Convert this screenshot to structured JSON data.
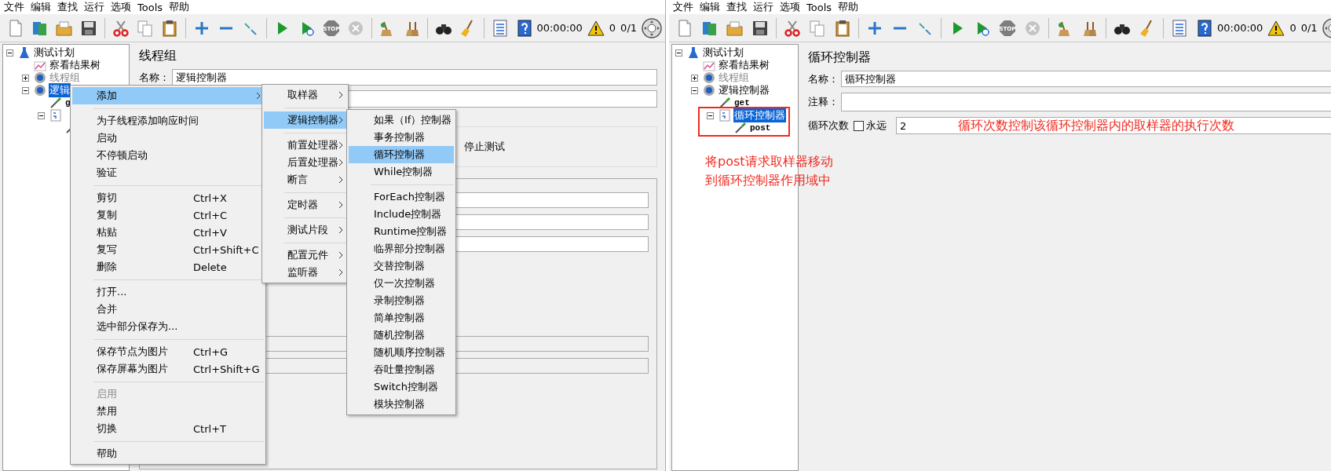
{
  "left_window": {
    "menu": [
      "文件",
      "编辑",
      "查找",
      "运行",
      "选项",
      "Tools",
      "帮助"
    ],
    "toolbar": [
      {
        "kind": "new"
      },
      {
        "kind": "templates"
      },
      {
        "kind": "open"
      },
      {
        "kind": "save"
      },
      {
        "kind": "sep"
      },
      {
        "kind": "cut"
      },
      {
        "kind": "copy"
      },
      {
        "kind": "paste"
      },
      {
        "kind": "sep"
      },
      {
        "kind": "expand"
      },
      {
        "kind": "collapse"
      },
      {
        "kind": "toggle"
      },
      {
        "kind": "sep"
      },
      {
        "kind": "start"
      },
      {
        "kind": "start_no_pause"
      },
      {
        "kind": "stop",
        "label": "STOP"
      },
      {
        "kind": "shutdown"
      },
      {
        "kind": "sep"
      },
      {
        "kind": "clear"
      },
      {
        "kind": "clear_all"
      },
      {
        "kind": "sep"
      },
      {
        "kind": "search"
      },
      {
        "kind": "reset"
      },
      {
        "kind": "sep"
      },
      {
        "kind": "function"
      },
      {
        "kind": "help"
      }
    ],
    "status": {
      "timer": "00:00:00",
      "warnings": "0",
      "threads": "0/1"
    },
    "tree": [
      {
        "label": "测试计划",
        "kind": "plan",
        "expanded": true,
        "selected": false,
        "disabled": false,
        "children": [
          {
            "label": "察看结果树",
            "kind": "listener",
            "selected": false,
            "disabled": false
          },
          {
            "label": "线程组",
            "kind": "gear",
            "expanded": false,
            "selected": false,
            "disabled": true
          },
          {
            "label": "逻辑",
            "kind": "gear",
            "expanded": true,
            "selected": true,
            "disabled": false,
            "children": [
              {
                "label": "g",
                "kind": "sampler",
                "selected": false,
                "disabled": false
              },
              {
                "kind": "loop",
                "expanded": true,
                "children": [
                  {
                    "kind": "sampler"
                  }
                ]
              }
            ]
          }
        ]
      }
    ],
    "panel": {
      "title": "线程组",
      "name_label": "名称：",
      "name_value": "逻辑控制器",
      "option": "停止测试",
      "upper_fields": [
        {
          "disabled": false
        },
        {
          "disabled": false
        },
        {
          "disabled": false
        }
      ],
      "lower_fields": [
        {
          "disabled": true
        },
        {
          "disabled": true
        }
      ]
    },
    "context_menu": [
      {
        "kind": "item",
        "label": "添加",
        "submenu": true,
        "selected": true,
        "disabled": false
      },
      {
        "kind": "separator"
      },
      {
        "kind": "item",
        "label": "为子线程添加响应时间",
        "selected": false,
        "disabled": false
      },
      {
        "kind": "item",
        "label": "启动",
        "selected": false,
        "disabled": false
      },
      {
        "kind": "item",
        "label": "不停顿启动",
        "selected": false,
        "disabled": false
      },
      {
        "kind": "item",
        "label": "验证",
        "selected": false,
        "disabled": false
      },
      {
        "kind": "separator"
      },
      {
        "kind": "item",
        "label": "剪切",
        "shortcut": "Ctrl+X",
        "selected": false,
        "disabled": false
      },
      {
        "kind": "item",
        "label": "复制",
        "shortcut": "Ctrl+C",
        "selected": false,
        "disabled": false
      },
      {
        "kind": "item",
        "label": "粘贴",
        "shortcut": "Ctrl+V",
        "selected": false,
        "disabled": false
      },
      {
        "kind": "item",
        "label": "复写",
        "shortcut": "Ctrl+Shift+C",
        "selected": false,
        "disabled": false
      },
      {
        "kind": "item",
        "label": "删除",
        "shortcut": "Delete",
        "selected": false,
        "disabled": false
      },
      {
        "kind": "separator"
      },
      {
        "kind": "item",
        "label": "打开...",
        "selected": false,
        "disabled": false
      },
      {
        "kind": "item",
        "label": "合并",
        "selected": false,
        "disabled": false
      },
      {
        "kind": "item",
        "label": "选中部分保存为...",
        "selected": false,
        "disabled": false
      },
      {
        "kind": "separator"
      },
      {
        "kind": "item",
        "label": "保存节点为图片",
        "shortcut": "Ctrl+G",
        "selected": false,
        "disabled": false
      },
      {
        "kind": "item",
        "label": "保存屏幕为图片",
        "shortcut": "Ctrl+Shift+G",
        "selected": false,
        "disabled": false
      },
      {
        "kind": "separator"
      },
      {
        "kind": "item",
        "label": "启用",
        "selected": false,
        "disabled": true
      },
      {
        "kind": "item",
        "label": "禁用",
        "selected": false,
        "disabled": false
      },
      {
        "kind": "item",
        "label": "切换",
        "shortcut": "Ctrl+T",
        "selected": false,
        "disabled": false
      },
      {
        "kind": "separator"
      },
      {
        "kind": "item",
        "label": "帮助",
        "selected": false,
        "disabled": false
      }
    ],
    "add_submenu": [
      {
        "kind": "item",
        "label": "取样器",
        "submenu": true,
        "selected": false,
        "disabled": false
      },
      {
        "kind": "separator"
      },
      {
        "kind": "item",
        "label": "逻辑控制器",
        "submenu": true,
        "selected": true,
        "disabled": false
      },
      {
        "kind": "separator"
      },
      {
        "kind": "item",
        "label": "前置处理器",
        "submenu": true,
        "selected": false,
        "disabled": false
      },
      {
        "kind": "item",
        "label": "后置处理器",
        "submenu": true,
        "selected": false,
        "disabled": false
      },
      {
        "kind": "item",
        "label": "断言",
        "submenu": true,
        "selected": false,
        "disabled": false
      },
      {
        "kind": "separator"
      },
      {
        "kind": "item",
        "label": "定时器",
        "submenu": true,
        "selected": false,
        "disabled": false
      },
      {
        "kind": "separator"
      },
      {
        "kind": "item",
        "label": "测试片段",
        "submenu": true,
        "selected": false,
        "disabled": false
      },
      {
        "kind": "separator"
      },
      {
        "kind": "item",
        "label": "配置元件",
        "submenu": true,
        "selected": false,
        "disabled": false
      },
      {
        "kind": "item",
        "label": "监听器",
        "submenu": true,
        "selected": false,
        "disabled": false
      }
    ],
    "controller_submenu": [
      {
        "kind": "item",
        "label": "如果（If）控制器",
        "selected": false,
        "disabled": false
      },
      {
        "kind": "item",
        "label": "事务控制器",
        "selected": false,
        "disabled": false
      },
      {
        "kind": "item",
        "label": "循环控制器",
        "selected": true,
        "disabled": false
      },
      {
        "kind": "item",
        "label": "While控制器",
        "selected": false,
        "disabled": false
      },
      {
        "kind": "separator"
      },
      {
        "kind": "item",
        "label": "ForEach控制器",
        "selected": false,
        "disabled": false
      },
      {
        "kind": "item",
        "label": "Include控制器",
        "selected": false,
        "disabled": false
      },
      {
        "kind": "item",
        "label": "Runtime控制器",
        "selected": false,
        "disabled": false
      },
      {
        "kind": "item",
        "label": "临界部分控制器",
        "selected": false,
        "disabled": false
      },
      {
        "kind": "item",
        "label": "交替控制器",
        "selected": false,
        "disabled": false
      },
      {
        "kind": "item",
        "label": "仅一次控制器",
        "selected": false,
        "disabled": false
      },
      {
        "kind": "item",
        "label": "录制控制器",
        "selected": false,
        "disabled": false
      },
      {
        "kind": "item",
        "label": "简单控制器",
        "selected": false,
        "disabled": false
      },
      {
        "kind": "item",
        "label": "随机控制器",
        "selected": false,
        "disabled": false
      },
      {
        "kind": "item",
        "label": "随机顺序控制器",
        "selected": false,
        "disabled": false
      },
      {
        "kind": "item",
        "label": "吞吐量控制器",
        "selected": false,
        "disabled": false
      },
      {
        "kind": "item",
        "label": "Switch控制器",
        "selected": false,
        "disabled": false
      },
      {
        "kind": "item",
        "label": "模块控制器",
        "selected": false,
        "disabled": false
      }
    ]
  },
  "right_window": {
    "menu": [
      "文件",
      "编辑",
      "查找",
      "运行",
      "选项",
      "Tools",
      "帮助"
    ],
    "toolbar": [
      {
        "kind": "new"
      },
      {
        "kind": "templates"
      },
      {
        "kind": "open"
      },
      {
        "kind": "save"
      },
      {
        "kind": "sep"
      },
      {
        "kind": "cut"
      },
      {
        "kind": "copy"
      },
      {
        "kind": "paste"
      },
      {
        "kind": "sep"
      },
      {
        "kind": "expand"
      },
      {
        "kind": "collapse"
      },
      {
        "kind": "toggle"
      },
      {
        "kind": "sep"
      },
      {
        "kind": "start"
      },
      {
        "kind": "start_no_pause"
      },
      {
        "kind": "stop",
        "label": "STOP"
      },
      {
        "kind": "shutdown"
      },
      {
        "kind": "sep"
      },
      {
        "kind": "clear"
      },
      {
        "kind": "clear_all"
      },
      {
        "kind": "sep"
      },
      {
        "kind": "search"
      },
      {
        "kind": "reset"
      },
      {
        "kind": "sep"
      },
      {
        "kind": "function"
      },
      {
        "kind": "help"
      }
    ],
    "status": {
      "timer": "00:00:00",
      "warnings": "0",
      "threads": "0/1"
    },
    "tree": [
      {
        "label": "测试计划",
        "kind": "plan",
        "expanded": true,
        "selected": false,
        "disabled": false,
        "children": [
          {
            "label": "察看结果树",
            "kind": "listener",
            "selected": false,
            "disabled": false
          },
          {
            "label": "线程组",
            "kind": "gear",
            "expanded": false,
            "selected": false,
            "disabled": true
          },
          {
            "label": "逻辑控制器",
            "kind": "gear",
            "expanded": true,
            "selected": false,
            "disabled": false,
            "children": [
              {
                "label": "get",
                "kind": "sampler",
                "selected": false,
                "disabled": false
              },
              {
                "label": "循环控制器",
                "kind": "loop",
                "expanded": true,
                "selected": true,
                "disabled": false,
                "children": [
                  {
                    "label": "post",
                    "kind": "sampler",
                    "selected": false,
                    "disabled": false
                  }
                ]
              }
            ]
          }
        ]
      }
    ],
    "panel": {
      "title": "循环控制器",
      "name_label": "名称：",
      "name_value": "循环控制器",
      "comment_label": "注释：",
      "loop_label": "循环次数",
      "forever": {
        "label": "永远",
        "checked": false
      },
      "loop_value": "2"
    },
    "annotations": {
      "field_note": "循环次数控制该循环控制器内的取样器的执行次数",
      "tree_note": [
        "将post请求取样器移动",
        "到循环控制器作用域中"
      ]
    }
  }
}
